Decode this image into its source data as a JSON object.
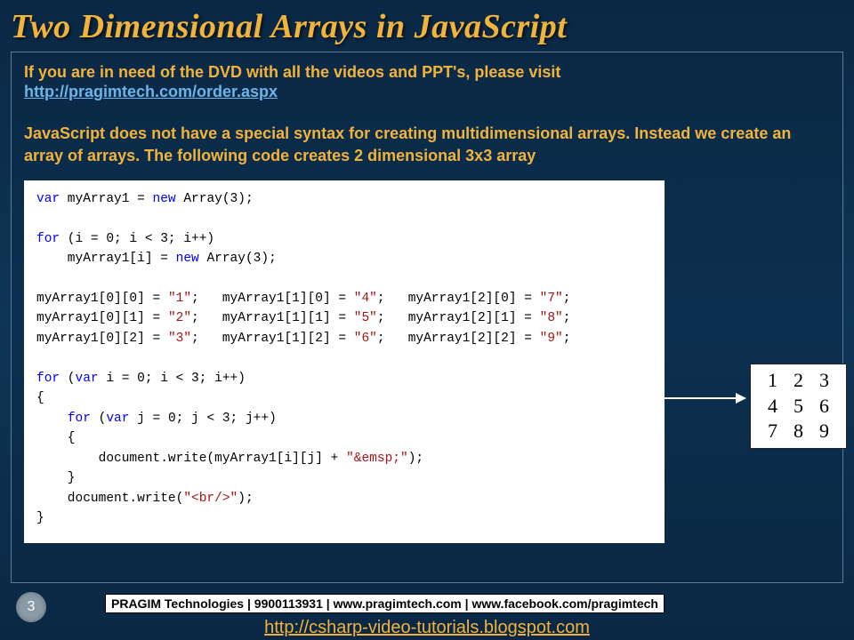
{
  "title": "Two Dimensional Arrays in JavaScript",
  "intro": {
    "line1": "If you are in need of the DVD with all the videos and PPT's, please visit",
    "link": "http://pragimtech.com/order.aspx"
  },
  "description": {
    "part1": "JavaScript does not have a special syntax for creating multidimensional arrays. Instead we create an array of arrays.",
    "part2": " The following code creates 2 dimensional 3x3 array"
  },
  "code": {
    "l1a": "var",
    "l1b": " myArray1 = ",
    "l1c": "new",
    "l1d": " Array(3);",
    "l2a": "for",
    "l2b": " (i = 0; i < 3; i++)",
    "l3a": "    myArray1[i] = ",
    "l3b": "new",
    "l3c": " Array(3);",
    "l4a": "myArray1[0][0] = ",
    "l4b": "\"1\"",
    "l4c": ";   myArray1[1][0] = ",
    "l4d": "\"4\"",
    "l4e": ";   myArray1[2][0] = ",
    "l4f": "\"7\"",
    "l4g": ";",
    "l5a": "myArray1[0][1] = ",
    "l5b": "\"2\"",
    "l5c": ";   myArray1[1][1] = ",
    "l5d": "\"5\"",
    "l5e": ";   myArray1[2][1] = ",
    "l5f": "\"8\"",
    "l5g": ";",
    "l6a": "myArray1[0][2] = ",
    "l6b": "\"3\"",
    "l6c": ";   myArray1[1][2] = ",
    "l6d": "\"6\"",
    "l6e": ";   myArray1[2][2] = ",
    "l6f": "\"9\"",
    "l6g": ";",
    "l7a": "for",
    "l7b": " (",
    "l7c": "var",
    "l7d": " i = 0; i < 3; i++)",
    "l8": "{",
    "l9a": "    ",
    "l9b": "for",
    "l9c": " (",
    "l9d": "var",
    "l9e": " j = 0; j < 3; j++)",
    "l10": "    {",
    "l11a": "        document.write(myArray1[i][j] + ",
    "l11b": "\"&emsp;\"",
    "l11c": ");",
    "l12": "    }",
    "l13a": "    document.write(",
    "l13b": "\"<br/>\"",
    "l13c": ");",
    "l14": "}"
  },
  "matrix": [
    [
      "1",
      "2",
      "3"
    ],
    [
      "4",
      "5",
      "6"
    ],
    [
      "7",
      "8",
      "9"
    ]
  ],
  "slideNumber": "3",
  "footerBox": "PRAGIM Technologies | 9900113931 | www.pragimtech.com | www.facebook.com/pragimtech",
  "footerLink": "http://csharp-video-tutorials.blogspot.com"
}
